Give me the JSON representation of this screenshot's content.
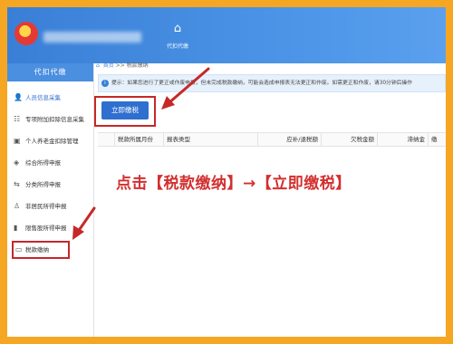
{
  "header": {
    "tool_glyph": "⌂",
    "tool_label": "代扣代缴"
  },
  "sidebar": {
    "title": "代扣代缴",
    "items": [
      {
        "label": "人员信息采集",
        "icon": "person-icon",
        "glyph": "👤"
      },
      {
        "label": "专项附加扣除信息采集",
        "icon": "list-icon",
        "glyph": "☷"
      },
      {
        "label": "个人养老金扣除管理",
        "icon": "card-icon",
        "glyph": "▣"
      },
      {
        "label": "综合所得申报",
        "icon": "layers-icon",
        "glyph": "◈"
      },
      {
        "label": "分类所得申报",
        "icon": "shuffle-icon",
        "glyph": "⇆"
      },
      {
        "label": "非居民所得申报",
        "icon": "user-outline-icon",
        "glyph": "♙"
      },
      {
        "label": "限售股所得申报",
        "icon": "bar-chart-icon",
        "glyph": "▮"
      },
      {
        "label": "税款缴纳",
        "icon": "folder-icon",
        "glyph": "▭"
      }
    ]
  },
  "breadcrumb": {
    "home": "首页",
    "separator": ">>",
    "current": "税款缴纳"
  },
  "notice": {
    "info_glyph": "i",
    "text": "提示：如果您进行了更正或作废申报，但未完成税款缴纳，可能会造成申报表无法更正和作废。如需更正和作废，请30分钟后操作"
  },
  "pay_button_label": "立即缴税",
  "table": {
    "columns": [
      "税款所属月份",
      "报表类型",
      "应补/退税额",
      "欠税金额",
      "滞纳金",
      "缴"
    ]
  },
  "instruction_text": "点击【税款缴纳】→【立即缴税】",
  "colors": {
    "accent": "#2f6fd0",
    "highlight": "#c62828",
    "frame": "#f5a623"
  }
}
